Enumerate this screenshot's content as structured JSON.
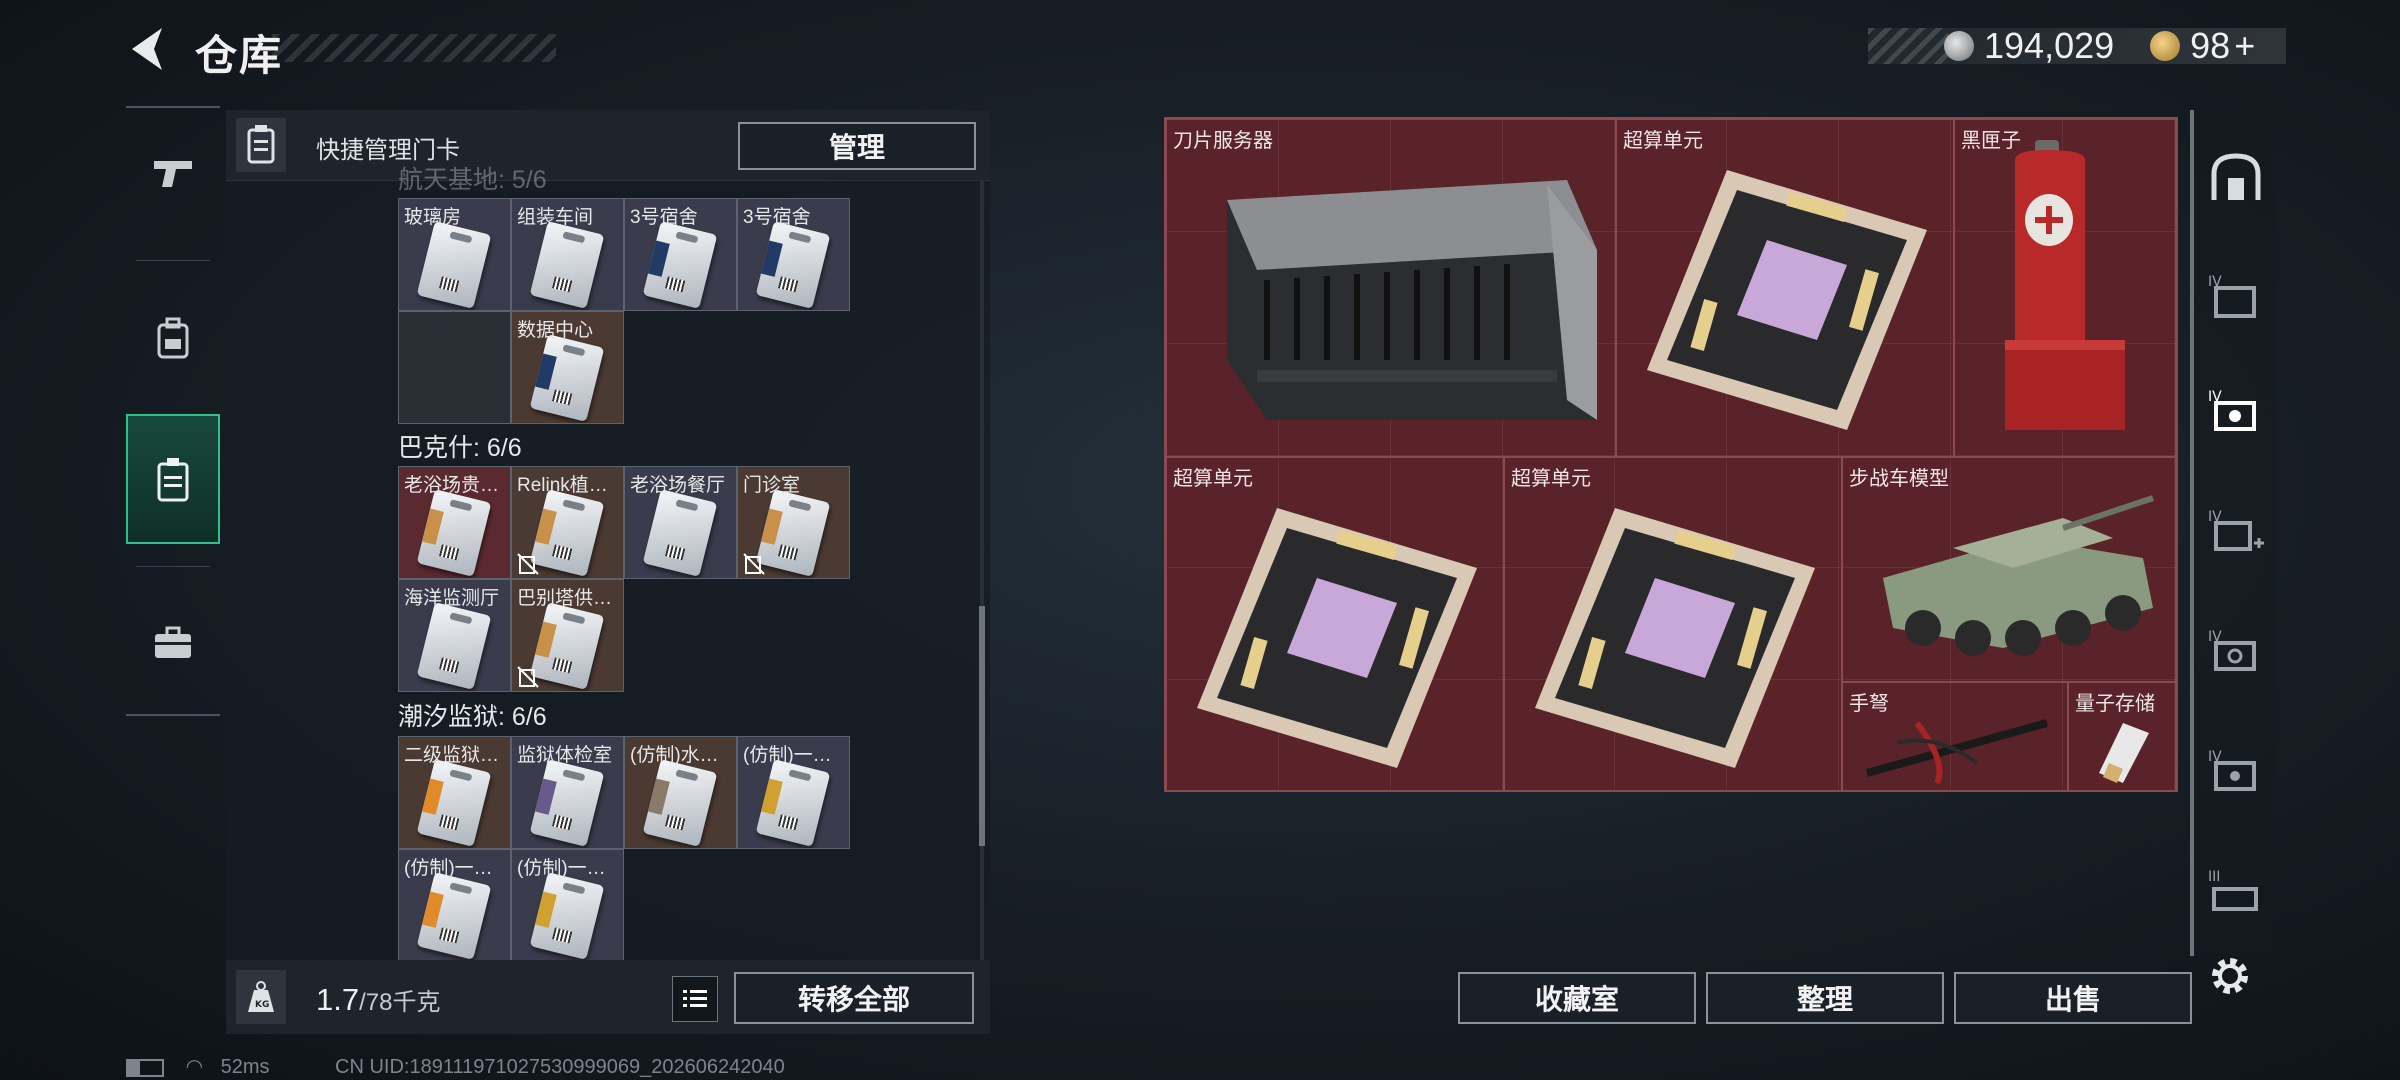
{
  "header": {
    "title": "仓库",
    "currency_1": "194,029",
    "currency_2": "98",
    "currency_2_plus": "+"
  },
  "left_panel": {
    "quick_manage_label": "快捷管理门卡",
    "manage_button": "管理",
    "faded_section": "航天基地: 5/6",
    "sections": [
      {
        "title": "巴克什: 6/6"
      },
      {
        "title": "潮汐监狱: 6/6"
      }
    ],
    "cards_top": [
      "玻璃房",
      "组装车间",
      "3号宿舍",
      "3号宿舍",
      "数据中心"
    ],
    "cards_bakshi": [
      "老浴场贵…",
      "Relink植…",
      "老浴场餐厅",
      "门诊室",
      "海洋监测厅",
      "巴别塔供…"
    ],
    "cards_prison": [
      "二级监狱…",
      "监狱体检室",
      "(仿制)水…",
      "(仿制)一…",
      "(仿制)一…",
      "(仿制)一…"
    ],
    "weight_value": "1.7",
    "weight_max": "/78千克",
    "transfer_all_button": "转移全部"
  },
  "right_panel": {
    "items": [
      "刀片服务器",
      "超算单元",
      "黑匣子",
      "超算单元",
      "超算单元",
      "步战车模型",
      "手弩",
      "量子存储"
    ],
    "collection_button": "收藏室",
    "sort_button": "整理",
    "sell_button": "出售"
  },
  "status_bar": {
    "ping": "52ms",
    "uid": "CN UID:1891119710275309990​69_202606242040"
  },
  "colors": {
    "accent_green": "#2ec08a",
    "item_bg": "#5a2329"
  }
}
